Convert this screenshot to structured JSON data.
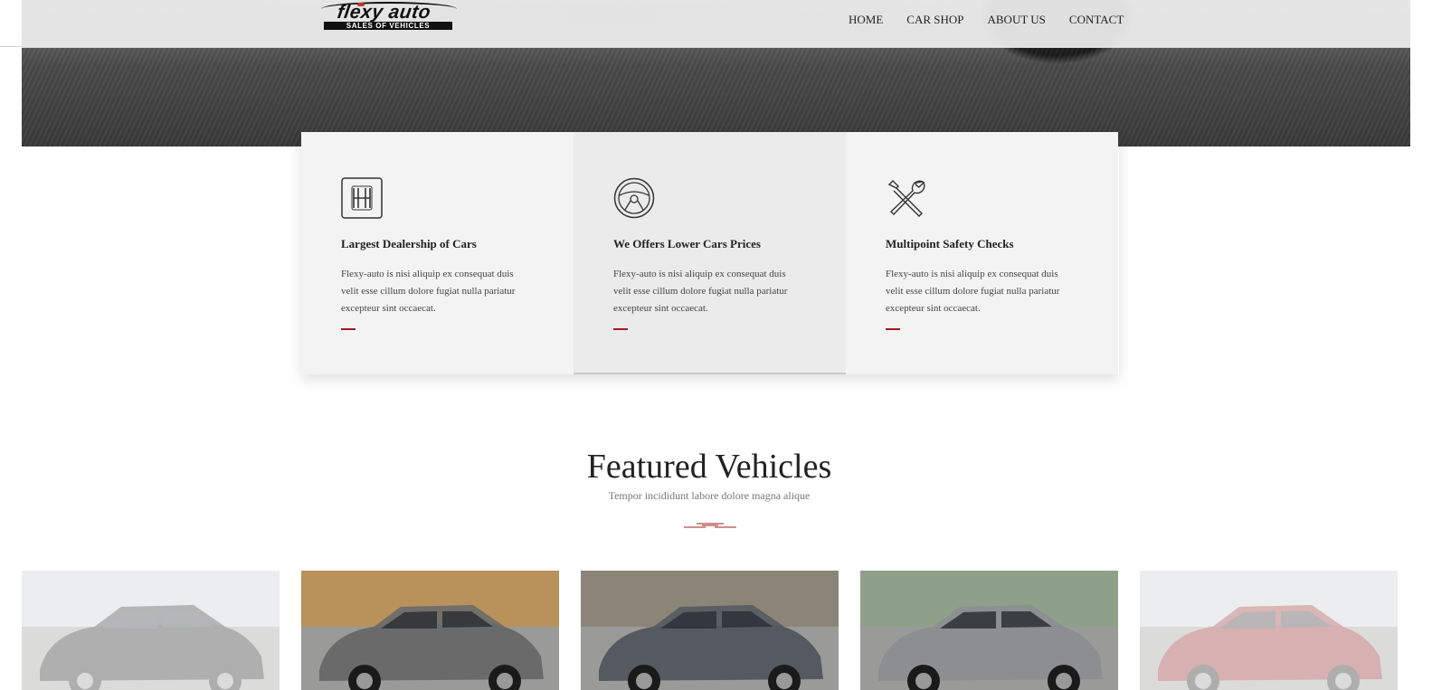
{
  "brand": {
    "name": "flexy auto",
    "tagline": "SALES OF VEHICLES"
  },
  "nav": [
    {
      "label": "HOME"
    },
    {
      "label": "CAR SHOP"
    },
    {
      "label": "ABOUT US"
    },
    {
      "label": "CONTACT"
    }
  ],
  "features": [
    {
      "icon": "gear-shift-icon",
      "title": "Largest Dealership of Cars",
      "text": "Flexy-auto is nisi aliquip ex consequat duis velit esse cillum dolore fugiat nulla pariatur excepteur sint occaecat."
    },
    {
      "icon": "steering-wheel-icon",
      "title": "We Offers Lower Cars Prices",
      "text": "Flexy-auto is nisi aliquip ex consequat duis velit esse cillum dolore fugiat nulla pariatur excepteur sint occaecat."
    },
    {
      "icon": "wrench-screwdriver-icon",
      "title": "Multipoint Safety Checks",
      "text": "Flexy-auto is nisi aliquip ex consequat duis velit esse cillum dolore fugiat nulla pariatur excepteur sint occaecat."
    }
  ],
  "featured": {
    "title": "Featured Vehicles",
    "subtitle": "Tempor incididunt labore dolore magna alique"
  },
  "vehicles": [
    {
      "name": "black-sedan",
      "color": "#1d1d1d",
      "faded": true
    },
    {
      "name": "grey-minivan",
      "color": "#6a6a6a",
      "faded": false
    },
    {
      "name": "grey-suv",
      "color": "#555a60",
      "faded": false
    },
    {
      "name": "silver-suv",
      "color": "#8c8e90",
      "faded": false
    },
    {
      "name": "red-suv",
      "color": "#8f1f24",
      "faded": true
    }
  ],
  "colors": {
    "accent": "#a31d1d",
    "topbar": "#eeeeee",
    "feature_bg": "#f3f3f3"
  }
}
